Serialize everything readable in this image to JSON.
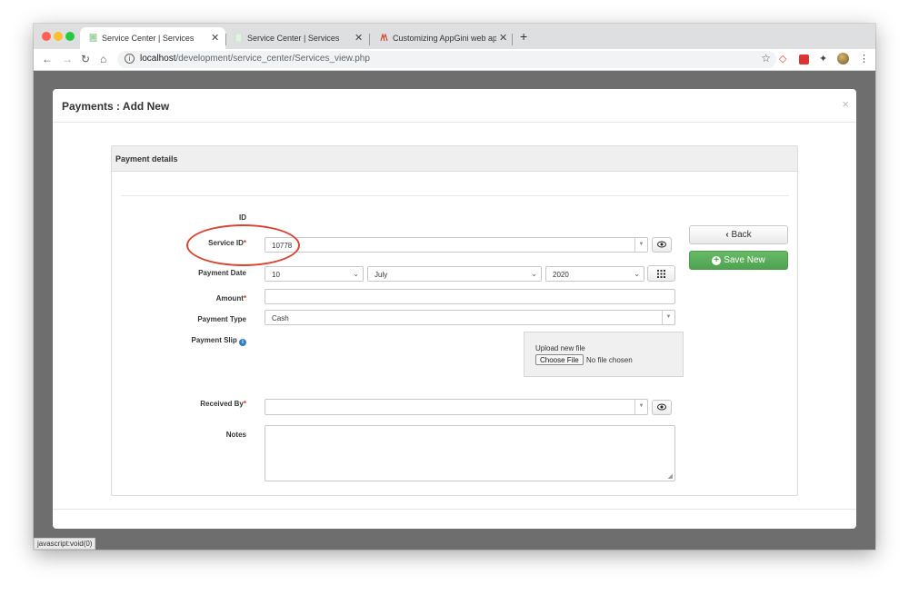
{
  "browser": {
    "tabs": [
      {
        "title": "Service Center | Services",
        "active": true,
        "favicon": "appgini-doc-icon",
        "color": "#a8d8a8"
      },
      {
        "title": "Service Center | Services",
        "active": false,
        "favicon": "appgini-doc-icon",
        "color": "#a8d8a8"
      },
      {
        "title": "Customizing AppGini web app",
        "active": false,
        "favicon": "appgini-logo-icon",
        "color": "#d9442f"
      }
    ],
    "close_glyph": "✕",
    "new_tab_glyph": "+",
    "url_host": "localhost",
    "url_path": "/development/service_center/Services_view.php",
    "nav_icons": [
      "back-arrow-icon",
      "forward-arrow-icon",
      "reload-icon",
      "home-icon"
    ],
    "extensions": [
      "star-icon",
      "appgini-ext-icon",
      "red-square-ext-icon",
      "puzzle-icon",
      "profile-avatar-icon",
      "kebab-menu-icon"
    ]
  },
  "modal": {
    "title": "Payments : Add New",
    "close_glyph": "×"
  },
  "panel": {
    "title": "Payment details"
  },
  "form": {
    "id_label": "ID",
    "service_id": {
      "label": "Service ID",
      "required_mark": "*",
      "value": "10778"
    },
    "payment_date": {
      "label": "Payment Date",
      "day": "10",
      "month": "July",
      "year": "2020"
    },
    "amount": {
      "label": "Amount",
      "required_mark": "*",
      "value": ""
    },
    "payment_type": {
      "label": "Payment Type",
      "value": "Cash"
    },
    "payment_slip": {
      "label": "Payment Slip",
      "upload_label": "Upload new file",
      "choose_button": "Choose File",
      "no_file": "No file chosen"
    },
    "received_by": {
      "label": "Received By",
      "required_mark": "*",
      "value": ""
    },
    "notes": {
      "label": "Notes",
      "value": ""
    }
  },
  "actions": {
    "back_label": "Back",
    "save_label": "Save New"
  },
  "status_bar": "javascript:void(0)",
  "colors": {
    "accent_green": "#5cb85c",
    "required_red": "#c0392b",
    "annotation_red": "#d9442f"
  }
}
